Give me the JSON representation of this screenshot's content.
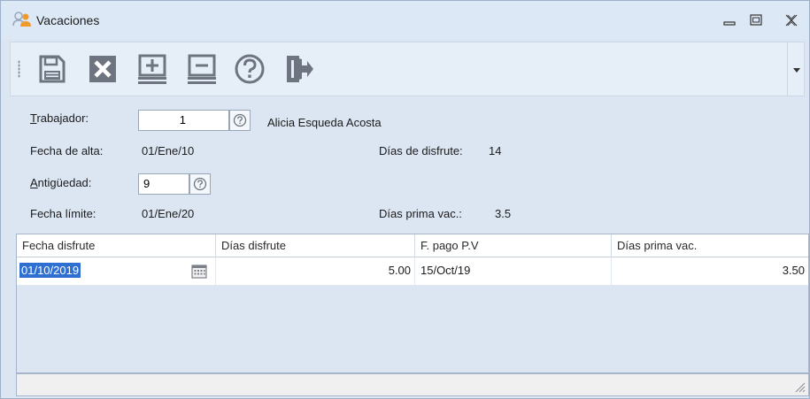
{
  "window": {
    "title": "Vacaciones",
    "icon": "users-icon",
    "controls": [
      "minimize-icon",
      "restore-icon",
      "close-icon"
    ]
  },
  "toolbar": {
    "buttons": [
      {
        "name": "save-button",
        "icon": "floppy-disk-icon"
      },
      {
        "name": "cancel-button",
        "icon": "x-icon"
      },
      {
        "name": "add-record-button",
        "icon": "add-record-icon"
      },
      {
        "name": "remove-record-button",
        "icon": "remove-record-icon"
      },
      {
        "name": "help-button",
        "icon": "question-icon"
      },
      {
        "name": "exit-button",
        "icon": "exit-door-icon"
      }
    ],
    "dropdown_icon": "chevron-down-icon"
  },
  "form": {
    "trabajador_label_first": "T",
    "trabajador_label_rest": "rabajador:",
    "trabajador_value": "1",
    "trabajador_name": "Alicia Esqueda Acosta",
    "fecha_alta_label": "Fecha de alta:",
    "fecha_alta_value": "01/Ene/10",
    "dias_disfrute_label": "Días de disfrute:",
    "dias_disfrute_value": "14",
    "antiguedad_label_first": "A",
    "antiguedad_label_rest": "ntigüedad:",
    "antiguedad_value": "9",
    "fecha_limite_label": "Fecha límite:",
    "fecha_limite_value": "01/Ene/20",
    "dias_prima_label": "Días prima vac.:",
    "dias_prima_value": "3.5"
  },
  "grid": {
    "columns": [
      "Fecha disfrute",
      "Días disfrute",
      "F. pago P.V",
      "Días prima vac."
    ],
    "rows": [
      {
        "fecha_disfrute": "01/10/2019",
        "dias_disfrute": "5.00",
        "f_pago": "15/Oct/19",
        "dias_prima": "3.50"
      }
    ]
  },
  "colors": {
    "accent": "#2f6fd1",
    "window_bg": "#dce6f3",
    "toolbar_icon": "#6f7580"
  }
}
